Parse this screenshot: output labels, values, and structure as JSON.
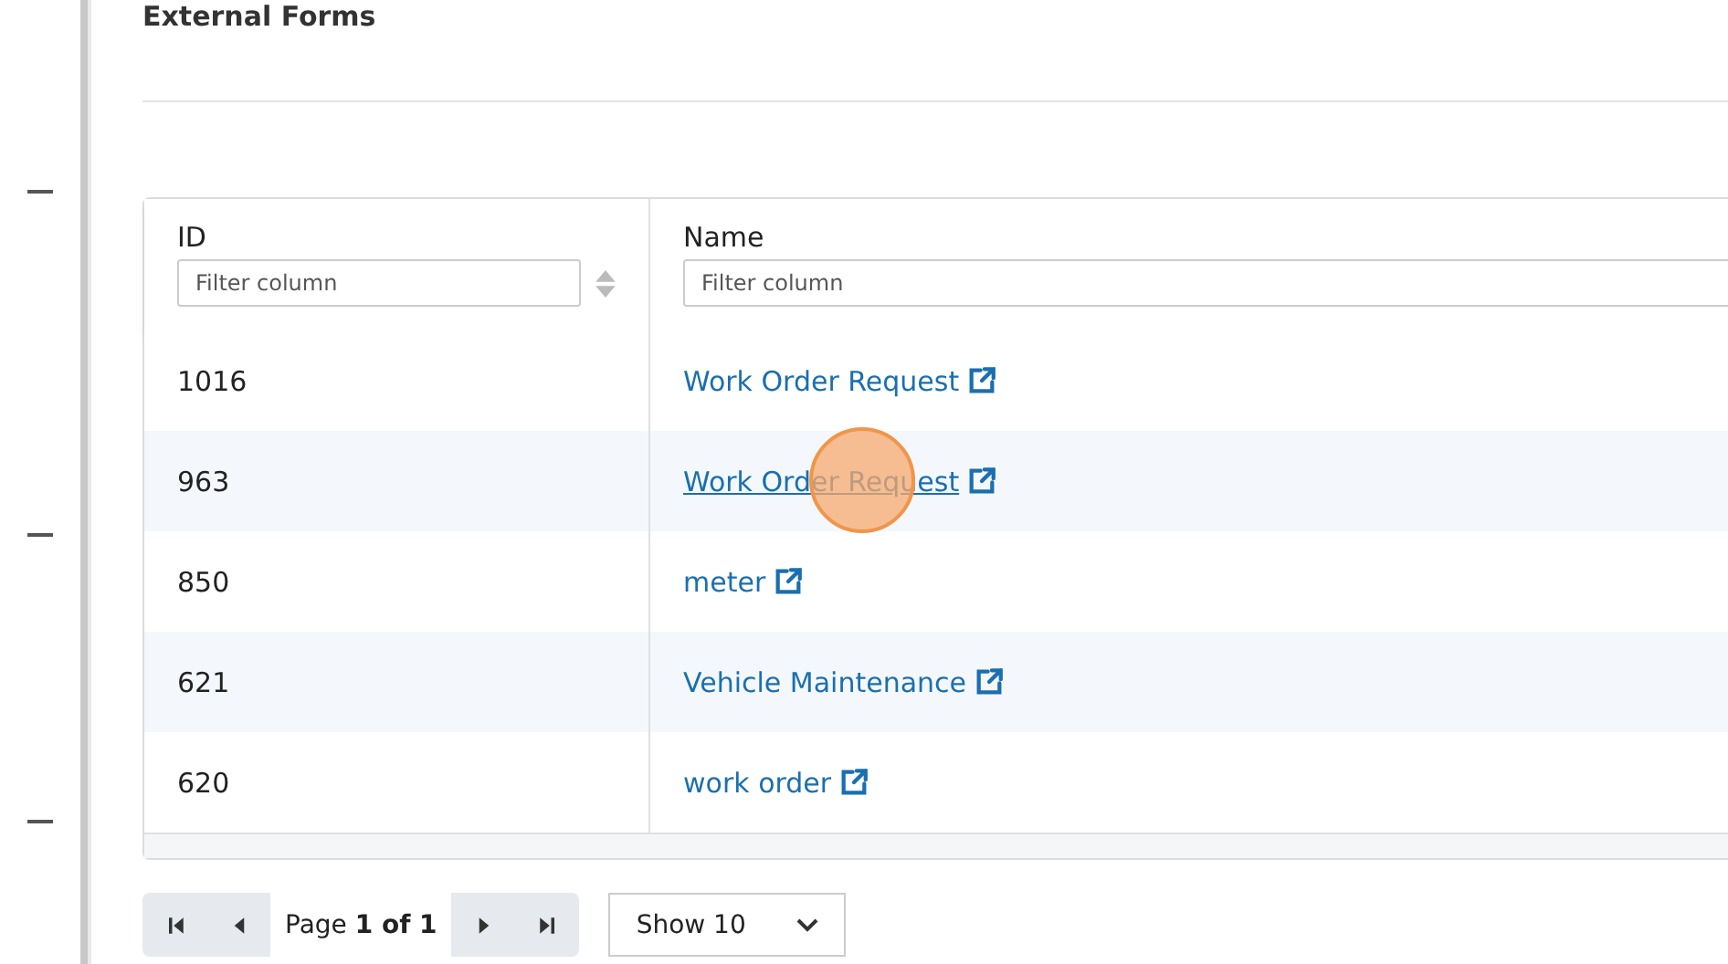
{
  "page": {
    "title": "External Forms"
  },
  "table": {
    "columns": [
      {
        "label": "ID",
        "placeholder": "Filter column",
        "sortable": true
      },
      {
        "label": "Name",
        "placeholder": "Filter column",
        "sortable": false
      }
    ],
    "rows": [
      {
        "id": "1016",
        "name": "Work Order Request",
        "hovered": false
      },
      {
        "id": "963",
        "name": "Work Order Request",
        "hovered": true
      },
      {
        "id": "850",
        "name": "meter",
        "hovered": false
      },
      {
        "id": "621",
        "name": "Vehicle Maintenance",
        "hovered": false
      },
      {
        "id": "620",
        "name": "work order",
        "hovered": false
      }
    ]
  },
  "pagination": {
    "page_label": "Page",
    "page_value": "1 of 1",
    "page_size": "Show 10"
  }
}
